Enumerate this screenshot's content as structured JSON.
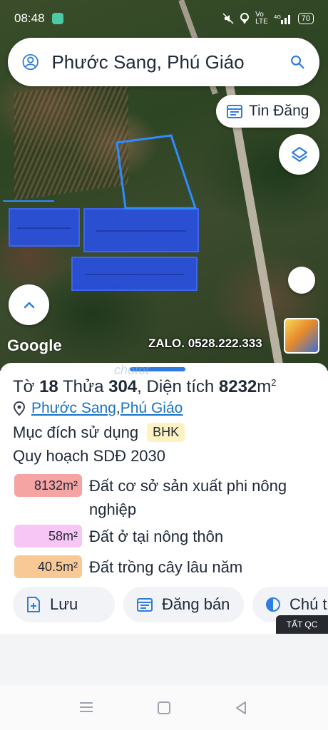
{
  "status": {
    "time": "08:48",
    "battery": "70"
  },
  "search": {
    "value": "Phước Sang, Phú Giáo"
  },
  "map": {
    "tin_dang_label": "Tin Đăng",
    "google_label": "Google",
    "watermark": "ZALO. 0528.222.333"
  },
  "sheet": {
    "watermark": "chotot",
    "title_prefix": "Tờ ",
    "sheet_no": "18",
    "title_mid": " Thửa ",
    "parcel_no": "304",
    "title_area_prefix": ", Diện tích ",
    "area_value": "8232",
    "area_unit": "m",
    "area_sup": "2",
    "location": {
      "ward": "Phước Sang",
      "separator": ", ",
      "district": "Phú Giáo"
    },
    "purpose_label": "Mục đích sử dụng",
    "purpose_code": "BHK",
    "plan_label": "Quy hoạch SDĐ 2030",
    "land_uses": [
      {
        "area": "8132m²",
        "label": "Đất cơ sở sản xuất phi nông nghiệp",
        "color": "#f5a3a3"
      },
      {
        "area": "58m²",
        "label": "Đất ở tại nông thôn",
        "color": "#f7c6f4"
      },
      {
        "area": "40.5m²",
        "label": "Đất trồng cây lâu năm",
        "color": "#f8c995"
      }
    ],
    "actions": {
      "save": "Lưu",
      "post": "Đăng bán",
      "note": "Chú t"
    },
    "ad_badge": "TẤT QC"
  },
  "colors": {
    "accent": "#1a73c8",
    "parcel_blue": "#2a50e0"
  }
}
